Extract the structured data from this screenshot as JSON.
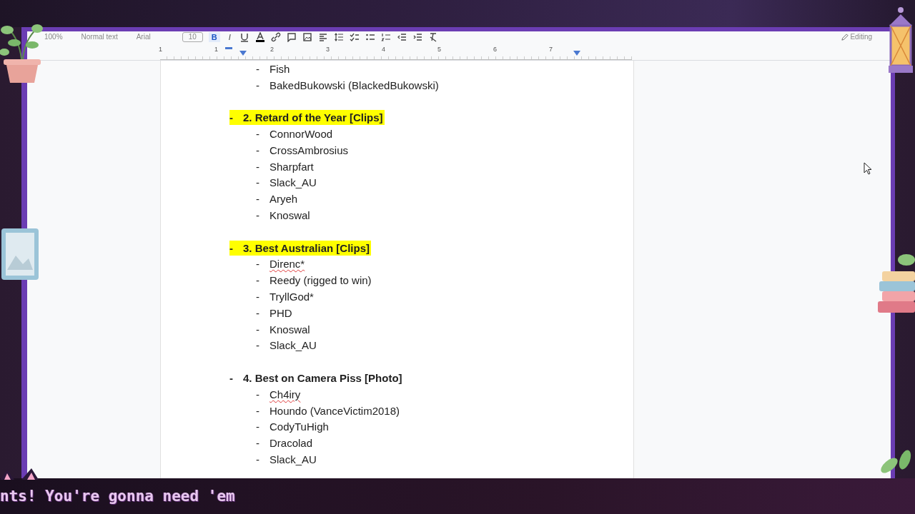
{
  "toolbar": {
    "zoom": "100%",
    "style": "Normal text",
    "font": "Arial",
    "size": "10",
    "format_buttons": [
      {
        "label": "B",
        "kind": "bold",
        "selected": true
      },
      {
        "label": "I",
        "kind": "italic",
        "selected": false
      }
    ],
    "mode": "Editing"
  },
  "ruler": {
    "labels": [
      "1",
      "1",
      "2",
      "3",
      "4",
      "5",
      "6",
      "7"
    ]
  },
  "document": {
    "continued_items": [
      {
        "text": "Fish",
        "misspelled": false
      },
      {
        "text": "BakedBukowski (BlackedBukowski)",
        "misspelled": false
      }
    ],
    "sections": [
      {
        "marker": "-",
        "heading": "2. Retard of the Year [Clips]",
        "highlighted": true,
        "items": [
          {
            "text": "ConnorWood",
            "misspelled": false
          },
          {
            "text": "CrossAmbrosius",
            "misspelled": false
          },
          {
            "text": "Sharpfart",
            "misspelled": false
          },
          {
            "text": "Slack_AU",
            "misspelled": false
          },
          {
            "text": "Aryeh",
            "misspelled": false
          },
          {
            "text": "Knoswal",
            "misspelled": false
          }
        ]
      },
      {
        "marker": "-",
        "heading": "3. Best Australian [Clips]",
        "highlighted": true,
        "items": [
          {
            "text": "Direnc*",
            "misspelled": true
          },
          {
            "text": "Reedy (rigged to win)",
            "misspelled": false
          },
          {
            "text": "TryllGod*",
            "misspelled": false
          },
          {
            "text": "PHD",
            "misspelled": false
          },
          {
            "text": "Knoswal",
            "misspelled": false
          },
          {
            "text": "Slack_AU",
            "misspelled": false
          }
        ]
      },
      {
        "marker": "-",
        "heading": "4. Best on Camera Piss [Photo]",
        "highlighted": false,
        "items": [
          {
            "text": "Ch4iry",
            "misspelled": true
          },
          {
            "text": "Houndo (VanceVictim2018)",
            "misspelled": false
          },
          {
            "text": "CodyTuHigh",
            "misspelled": false
          },
          {
            "text": "Dracolad",
            "misspelled": false
          },
          {
            "text": "Slack_AU",
            "misspelled": false
          }
        ]
      }
    ]
  },
  "ticker": {
    "text": "nts! You're gonna need 'em"
  }
}
